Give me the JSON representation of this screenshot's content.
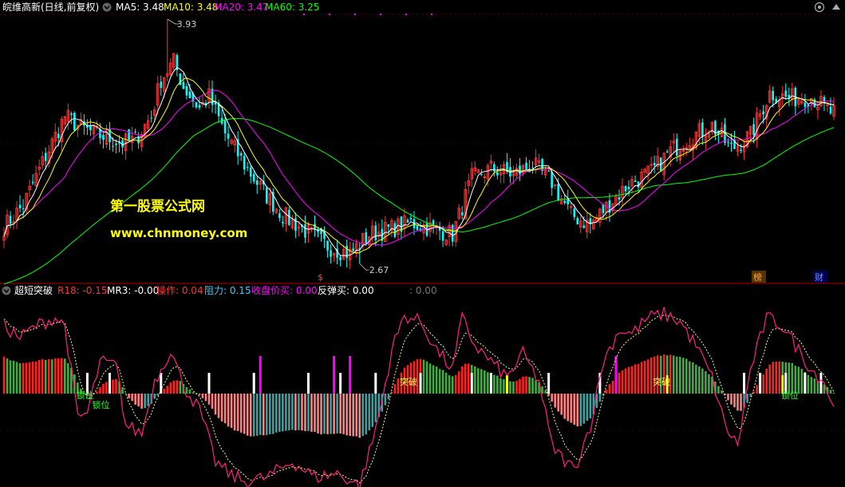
{
  "top_panel": {
    "title": "皖维高新(日线,前复权)",
    "indicators": [
      {
        "label": "MA5: 3.48",
        "color": "#ffffff"
      },
      {
        "label": "MA10: 3.48",
        "color": "#ffff00"
      },
      {
        "label": "MA20: 3.47",
        "color": "#ff00ff"
      },
      {
        "label": "MA60: 3.25",
        "color": "#00ff00"
      }
    ],
    "watermark_title": "第一股票公式网",
    "watermark_url": "www.chnmoney.com",
    "high_label": "3.93",
    "low_label": "2.67",
    "markers": [
      "$",
      "榜",
      "财"
    ]
  },
  "bottom_panel": {
    "title": "超短突破",
    "indicators": [
      {
        "label": "R18: -0.15",
        "color": "#ff3333"
      },
      {
        "label": "MR3: -0.00",
        "color": "#ffffff"
      },
      {
        "label": "操作: 0.04",
        "color": "#ff3333"
      },
      {
        "label": "阻力: 0.15",
        "color": "#33ccff"
      },
      {
        "label": "收盘价买: 0.00",
        "color": "#ff00ff"
      },
      {
        "label": "反弹买: 0.00",
        "color": "#ffffff"
      },
      {
        "label": ": 0.00",
        "color": "#777777"
      }
    ],
    "signals": {
      "suowei": "锁位",
      "tupo": "突破"
    }
  },
  "colors": {
    "background": "#000000",
    "up": "#ff3333",
    "down": "#00ffff",
    "ma5": "#ffffff",
    "ma10": "#ffff00",
    "ma20": "#ff00ff",
    "ma60": "#00ff00",
    "watermark": "#ffff00",
    "separator": "#b00000",
    "grid": "#550000"
  },
  "chart_data": [
    {
      "type": "candlestick",
      "y_range": [
        2.67,
        3.93
      ],
      "series": [
        {
          "name": "MA5",
          "values_key": "ma5"
        },
        {
          "name": "MA10",
          "values_key": "ma10"
        },
        {
          "name": "MA20",
          "values_key": "ma20"
        },
        {
          "name": "MA60",
          "values_key": "ma60"
        }
      ],
      "anchors": [
        [
          0,
          2.86
        ],
        [
          6,
          2.97
        ],
        [
          12,
          3.19
        ],
        [
          19,
          3.43
        ],
        [
          24,
          3.37
        ],
        [
          30,
          3.33
        ],
        [
          37,
          3.29
        ],
        [
          41,
          3.31
        ],
        [
          46,
          3.43
        ],
        [
          49,
          3.62
        ],
        [
          53,
          3.71
        ],
        [
          56,
          3.58
        ],
        [
          61,
          3.47
        ],
        [
          64,
          3.53
        ],
        [
          69,
          3.34
        ],
        [
          75,
          3.18
        ],
        [
          81,
          3.04
        ],
        [
          87,
          2.92
        ],
        [
          94,
          2.84
        ],
        [
          101,
          2.76
        ],
        [
          108,
          2.72
        ],
        [
          114,
          2.82
        ],
        [
          121,
          2.85
        ],
        [
          127,
          2.88
        ],
        [
          134,
          2.85
        ],
        [
          140,
          2.82
        ],
        [
          146,
          3.11
        ],
        [
          152,
          3.16
        ],
        [
          159,
          3.13
        ],
        [
          165,
          3.18
        ],
        [
          171,
          3.09
        ],
        [
          177,
          2.92
        ],
        [
          183,
          2.87
        ],
        [
          189,
          2.98
        ],
        [
          195,
          3.08
        ],
        [
          202,
          3.14
        ],
        [
          208,
          3.25
        ],
        [
          215,
          3.33
        ],
        [
          221,
          3.38
        ],
        [
          227,
          3.26
        ],
        [
          233,
          3.33
        ],
        [
          239,
          3.55
        ],
        [
          245,
          3.52
        ],
        [
          252,
          3.53
        ],
        [
          258,
          3.45
        ]
      ],
      "high_value": 3.93,
      "low_value": 2.67,
      "high_index": 51,
      "low_index": 111
    },
    {
      "type": "bar",
      "y_range": [
        -1.3,
        1.3
      ],
      "anchors": [
        [
          0,
          0.85
        ],
        [
          5,
          0.7
        ],
        [
          10,
          0.85
        ],
        [
          16,
          0.95
        ],
        [
          19,
          0.85
        ],
        [
          23,
          -0.3
        ],
        [
          26,
          -0.25
        ],
        [
          30,
          0.4
        ],
        [
          35,
          0.35
        ],
        [
          38,
          -0.4
        ],
        [
          43,
          -0.5
        ],
        [
          47,
          0.15
        ],
        [
          52,
          0.55
        ],
        [
          56,
          0.1
        ],
        [
          61,
          -0.2
        ],
        [
          66,
          -0.85
        ],
        [
          70,
          -1.0
        ],
        [
          75,
          -1.1
        ],
        [
          82,
          -1.05
        ],
        [
          90,
          -0.85
        ],
        [
          97,
          -1.05
        ],
        [
          104,
          -1.0
        ],
        [
          111,
          -1.15
        ],
        [
          115,
          -0.6
        ],
        [
          118,
          -0.1
        ],
        [
          121,
          0.55
        ],
        [
          125,
          0.98
        ],
        [
          130,
          0.9
        ],
        [
          135,
          0.55
        ],
        [
          140,
          0.3
        ],
        [
          143,
          0.95
        ],
        [
          147,
          0.6
        ],
        [
          152,
          0.4
        ],
        [
          157,
          0.2
        ],
        [
          162,
          0.5
        ],
        [
          167,
          0.15
        ],
        [
          171,
          -0.65
        ],
        [
          174,
          -0.8
        ],
        [
          178,
          -0.95
        ],
        [
          183,
          -0.4
        ],
        [
          187,
          0.4
        ],
        [
          192,
          0.8
        ],
        [
          196,
          0.75
        ],
        [
          201,
          0.95
        ],
        [
          206,
          1.0
        ],
        [
          211,
          0.9
        ],
        [
          216,
          0.6
        ],
        [
          221,
          0.2
        ],
        [
          225,
          -0.4
        ],
        [
          229,
          -0.65
        ],
        [
          233,
          0.3
        ],
        [
          238,
          0.95
        ],
        [
          243,
          0.85
        ],
        [
          248,
          0.55
        ],
        [
          252,
          0.3
        ],
        [
          256,
          0.15
        ],
        [
          259,
          -0.2
        ]
      ],
      "white_signals": [
        26,
        33,
        49,
        64,
        78,
        95,
        105,
        116,
        130,
        146,
        152,
        170,
        186,
        231,
        236,
        244,
        250,
        255
      ],
      "magenta_signals": [
        80,
        103,
        108,
        191
      ],
      "yellow_signals": [
        157,
        207,
        243
      ],
      "suowei_indices": [
        25,
        30,
        245
      ],
      "tupo_indices": [
        126,
        205
      ]
    }
  ]
}
